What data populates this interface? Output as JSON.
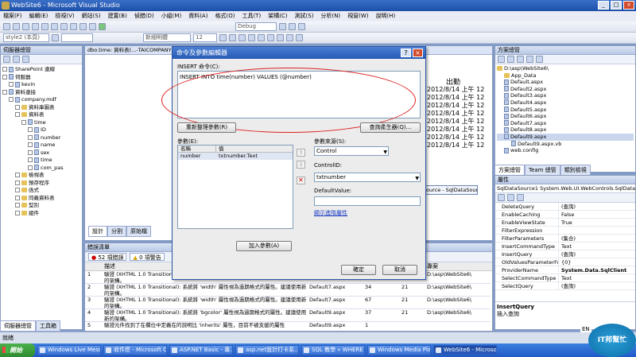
{
  "window": {
    "title": "WebSite6 - Microsoft Visual Studio"
  },
  "menu": [
    "檔案(F)",
    "編輯(E)",
    "檢視(V)",
    "網站(S)",
    "建置(B)",
    "偵錯(D)",
    "小組(M)",
    "資料(A)",
    "格式(O)",
    "工具(T)",
    "架構(C)",
    "測試(S)",
    "分析(N)",
    "視窗(W)",
    "說明(H)"
  ],
  "toolbar": {
    "config": "Debug",
    "style": "style2 (本頁)",
    "font": "新細明體",
    "size": "12"
  },
  "server_explorer": {
    "title": "伺服器總管",
    "items": [
      "SharePoint 連線",
      "伺服器",
      "kevin",
      "資料連接",
      "company.mdf",
      "資料庫圖表",
      "資料表",
      "time",
      "ID",
      "number",
      "name",
      "sex",
      "time",
      "com_pas",
      "檢視表",
      "預存程序",
      "函式",
      "同義資料表",
      "型別",
      "組件"
    ],
    "tabs": [
      "伺服器總管",
      "工具箱"
    ]
  },
  "editor": {
    "tabs": [
      "dbo.time: 資料表(...-TAICOMPANY"
    ],
    "header_right": "出勤",
    "rows": [
      "2012/8/14 上午 12",
      "2012/8/14 上午 12",
      "2012/8/14 上午 12",
      "2012/8/14 上午 12",
      "2012/8/14 上午 12",
      "2012/8/14 上午 12",
      "2012/8/14 上午 12",
      "2012/8/14 上午 12"
    ],
    "bottom_tabs": [
      "設計",
      "分割",
      "原始檔"
    ],
    "tooltip": "ource - SqlDataSource1"
  },
  "dialog": {
    "title": "命令及參數編輯器",
    "insert_label": "INSERT 命令(C):",
    "command_text": "INSERT INTO time(number) VALUES (@number)",
    "refresh_button": "重新整理參數(R)",
    "query_builder_button": "查詢產生器(Q)...",
    "params_label": "參數(E):",
    "col_name": "名稱",
    "col_value": "值",
    "param_name": "number",
    "param_value": "txtnumber.Text",
    "source_label": "參數來源(S):",
    "source_value": "Control",
    "controlid_label": "ControlID:",
    "controlid_value": "txtnumber",
    "default_label": "DefaultValue:",
    "advanced_link": "顯示進階屬性",
    "add_param_button": "加入參數(A)",
    "ok_button": "確定",
    "cancel_button": "取消"
  },
  "error_list": {
    "title": "錯誤清單",
    "errors_tab": "52 項錯誤",
    "warnings_tab": "0 項警告",
    "col_desc": "描述",
    "col_project": "專案",
    "rows": [
      {
        "num": "1",
        "desc": "驗證 (XHTML 1.0 Transitional): 系統將 'width' 屬性視為過期格式的屬性。建議使用新的架構。",
        "file": "",
        "line": "",
        "col": "",
        "proj": "D:\\asp\\WebSite6\\"
      },
      {
        "num": "2",
        "desc": "驗證 (XHTML 1.0 Transitional): 系統將 'width' 屬性視為過期格式的屬性。建議使用新的架構。",
        "file": "Default7.aspx",
        "line": "34",
        "col": "21",
        "proj": "D:\\asp\\WebSite6\\"
      },
      {
        "num": "3",
        "desc": "驗證 (XHTML 1.0 Transitional): 系統將 'width' 屬性視為過期格式的屬性。建議使用新的架構。",
        "file": "Default7.aspx",
        "line": "67",
        "col": "21",
        "proj": "D:\\asp\\WebSite6\\"
      },
      {
        "num": "4",
        "desc": "驗證 (XHTML 1.0 Transitional): 系統將 'bgcolor' 屬性視為過期格式的屬性。建議使用新的架構。",
        "file": "Default9.aspx",
        "line": "37",
        "col": "21",
        "proj": "D:\\asp\\WebSite6\\"
      },
      {
        "num": "5",
        "desc": "驗證元件找到了在欄位中定義在的說明比 'inherits' 屬性，目前不被支援的屬性",
        "file": "Default9.aspx",
        "line": "1",
        "col": "",
        "proj": ""
      }
    ]
  },
  "solution_explorer": {
    "title": "方案總管",
    "items": [
      "D:\\asp\\WebSite6\\",
      "App_Data",
      "Default.aspx",
      "Default2.aspx",
      "Default3.aspx",
      "Default4.aspx",
      "Default5.aspx",
      "Default6.aspx",
      "Default7.aspx",
      "Default8.aspx",
      "Default9.aspx",
      "Default9.aspx.vb",
      "web.config"
    ],
    "tabs": [
      "方案總管",
      "Team 總管",
      "類別檢視"
    ]
  },
  "properties": {
    "title": "屬性",
    "object": "SqlDataSource1 System.Web.UI.WebControls.SqlDataSource",
    "rows": [
      [
        "DeleteQuery",
        "(查詢)"
      ],
      [
        "EnableCaching",
        "False"
      ],
      [
        "EnableViewState",
        "True"
      ],
      [
        "FilterExpression",
        ""
      ],
      [
        "FilterParameters",
        "(集合)"
      ],
      [
        "InsertCommandType",
        "Text"
      ],
      [
        "InsertQuery",
        "(查詢)"
      ],
      [
        "OldValuesParameterFormat",
        "{0}"
      ],
      [
        "ProviderName",
        "System.Data.SqlClient"
      ],
      [
        "SelectCommandType",
        "Text"
      ],
      [
        "SelectQuery",
        "(查詢)"
      ]
    ],
    "desc_title": "InsertQuery",
    "desc_text": "插入查詢"
  },
  "status": {
    "text": "就緒"
  },
  "taskbar": {
    "start": "開始",
    "tasks": [
      "Windows Live Messe...",
      "收件匣 - Microsoft O...",
      "ASP.NET Basic - 專...",
      "asp.net設計打卡系...",
      "SQL 教學 » WHERE ...",
      "Windows Media Player",
      "WebSite6 - Microsoft..."
    ],
    "lang": "EN",
    "watermark": "IT邦幫忙"
  }
}
